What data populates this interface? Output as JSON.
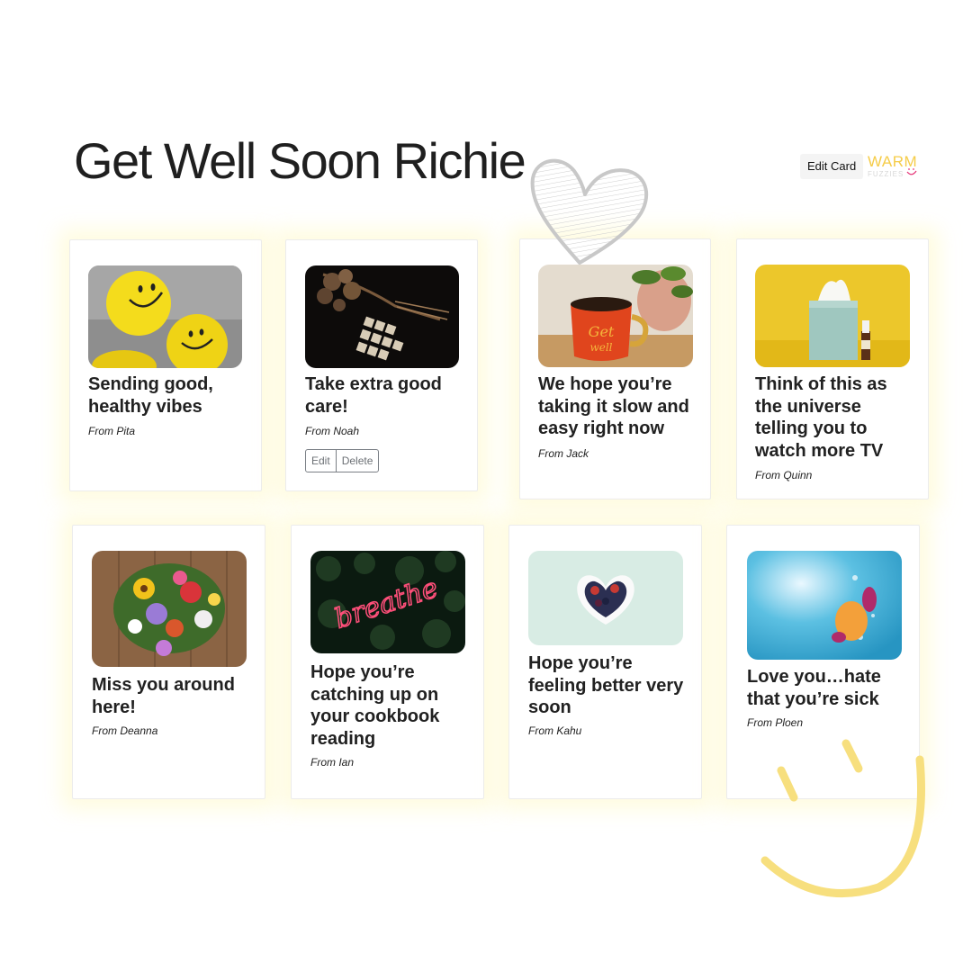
{
  "header": {
    "title": "Get Well Soon Richie",
    "edit_card_label": "Edit Card",
    "logo_top": "WARM",
    "logo_bottom": "FUZZIES"
  },
  "colors": {
    "accent_yellow": "#f5cc48",
    "card_glow": "#fffac8"
  },
  "decorations": [
    "heart-doodle",
    "smiley-doodle"
  ],
  "cards": [
    {
      "image": "smiley-balls-photo",
      "message": "Sending good, healthy vibes",
      "from": "From Pita"
    },
    {
      "image": "dried-flowers-get-well-tiles-photo",
      "message": "Take extra good care!",
      "from": "From Noah",
      "actions": {
        "edit": "Edit",
        "delete": "Delete"
      }
    },
    {
      "image": "get-well-mug-photo",
      "message": "We hope you’re taking it slow and easy right now",
      "from": "From Jack"
    },
    {
      "image": "tissue-box-photo",
      "message": "Think of this as the universe telling you to watch more TV",
      "from": "From Quinn"
    },
    {
      "image": "flower-bouquet-photo",
      "message": "Miss you around here!",
      "from": "From Deanna"
    },
    {
      "image": "breathe-neon-sign-photo",
      "message": "Hope you’re catching up on your cookbook reading",
      "from": "From Ian"
    },
    {
      "image": "heart-bowl-berries-photo",
      "message": "Hope you’re feeling better very soon",
      "from": "From Kahu"
    },
    {
      "image": "fruit-in-water-photo",
      "message": "Love you…hate that you’re sick",
      "from": "From Ploen"
    }
  ]
}
